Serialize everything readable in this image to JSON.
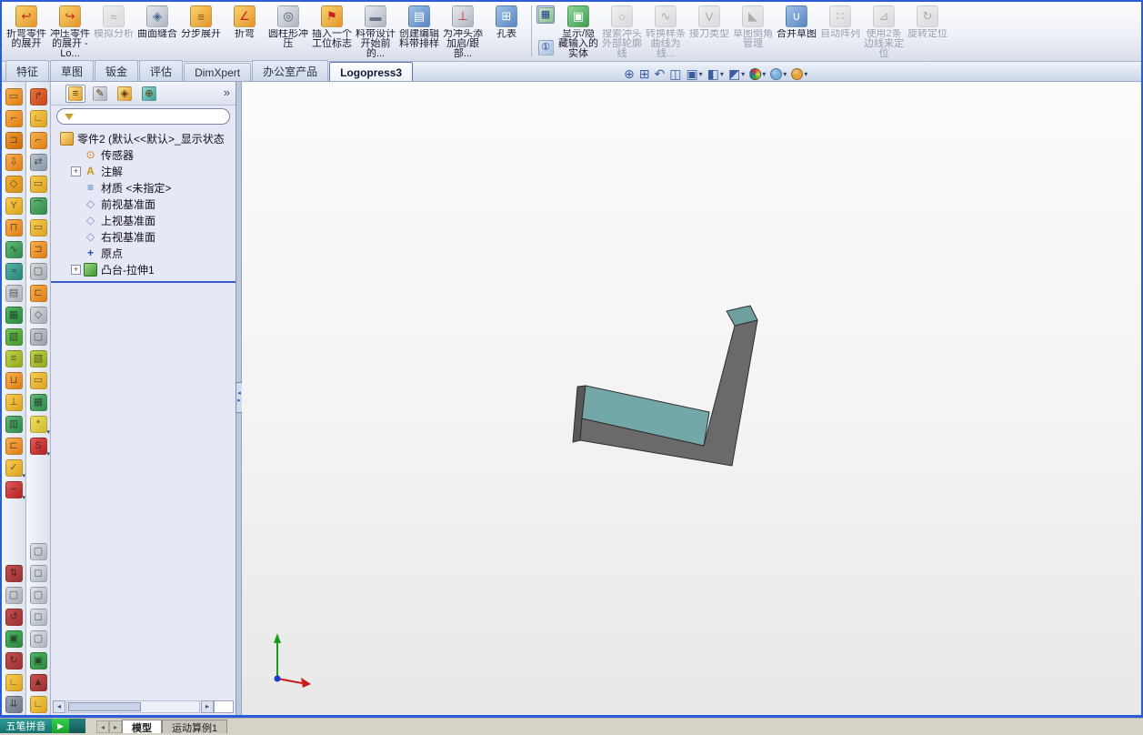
{
  "window": {
    "border_color": "#2b5bd7"
  },
  "toolbar": {
    "items": [
      {
        "name": "unfold-bent-part",
        "label": "折弯零件的展开",
        "enabled": true,
        "c1": "#fad46a",
        "c2": "#e2952e",
        "glyph": "↩",
        "gc": "#cc2020"
      },
      {
        "name": "unfold-stamped-part",
        "label": "冲压零件的展开 - Lo...",
        "enabled": true,
        "c1": "#fad46a",
        "c2": "#e2952e",
        "glyph": "↪",
        "gc": "#cc2020"
      },
      {
        "name": "simulation-analysis",
        "label": "模拟分析",
        "enabled": false,
        "c1": "#e2e4e8",
        "c2": "#c2c6cc",
        "glyph": "≈",
        "gc": "#667088"
      },
      {
        "name": "surface-knit",
        "label": "曲面缝合",
        "enabled": true,
        "c1": "#e6e9ee",
        "c2": "#aeb6c2",
        "glyph": "◈",
        "gc": "#4a6a9a"
      },
      {
        "name": "step-unfold",
        "label": "分步展开",
        "enabled": true,
        "c1": "#fad46a",
        "c2": "#e2952e",
        "glyph": "≡",
        "gc": "#8a5a10"
      },
      {
        "name": "bend",
        "label": "折弯",
        "enabled": true,
        "c1": "#fad46a",
        "c2": "#e2952e",
        "glyph": "∠",
        "gc": "#cc2020"
      },
      {
        "name": "cylindrical-stamp",
        "label": "圆柱形冲压",
        "enabled": true,
        "c1": "#e6e9ee",
        "c2": "#aeb6c2",
        "glyph": "◎",
        "gc": "#55606e"
      },
      {
        "name": "insert-station-flag",
        "label": "插入一个工位标志",
        "enabled": true,
        "c1": "#fad46a",
        "c2": "#e2952e",
        "glyph": "⚑",
        "gc": "#cc2020"
      },
      {
        "name": "strip-design-start",
        "label": "料带设计开始前的...",
        "enabled": true,
        "c1": "#e6e9ee",
        "c2": "#aeb6c2",
        "glyph": "▬",
        "gc": "#6a7482"
      },
      {
        "name": "create-edit-strip-layout",
        "label": "创建编辑料带排样",
        "enabled": true,
        "c1": "#9ec2e8",
        "c2": "#5a86c0",
        "glyph": "▤",
        "gc": "#ffffff"
      },
      {
        "name": "add-punch-heel",
        "label": "为冲头添加启/跟部...",
        "enabled": true,
        "c1": "#e6e9ee",
        "c2": "#aeb6c2",
        "glyph": "⊥",
        "gc": "#cc2020"
      },
      {
        "name": "hole-table",
        "label": "孔表",
        "enabled": true,
        "c1": "#9ec2e8",
        "c2": "#5a86c0",
        "glyph": "⊞",
        "gc": "#ffffff"
      },
      {
        "type": "sep"
      },
      {
        "type": "stack",
        "buttons": [
          {
            "n": "show-hide-strip-toggle",
            "g": "▦",
            "c1": "#cfe6cf",
            "c2": "#8fbf8f",
            "pressed": true
          },
          {
            "n": "info-toggle",
            "g": "①",
            "c1": "#dde6f5",
            "c2": "#aac0e0",
            "pressed": false
          }
        ]
      },
      {
        "name": "show-hide-imported-bodies",
        "label": "显示/隐藏输入的实体",
        "enabled": true,
        "c1": "#8fd89a",
        "c2": "#3f9c4f",
        "glyph": "▣",
        "gc": "#ffffff"
      },
      {
        "name": "search-punch-outline",
        "label": "搜索冲头外部轮廓线",
        "enabled": false,
        "c1": "#e2e4e8",
        "c2": "#c2c6cc",
        "glyph": "○",
        "gc": "#667088"
      },
      {
        "name": "convert-spline-to-line",
        "label": "转换样条曲线为线...",
        "enabled": false,
        "c1": "#e2e4e8",
        "c2": "#c2c6cc",
        "glyph": "∿",
        "gc": "#667088"
      },
      {
        "name": "joint-type",
        "label": "接刀类型",
        "enabled": false,
        "c1": "#e2e4e8",
        "c2": "#c2c6cc",
        "glyph": "V",
        "gc": "#667088"
      },
      {
        "name": "sketch-chamfer-manager",
        "label": "草图倒角管理",
        "enabled": false,
        "c1": "#e2e4e8",
        "c2": "#c2c6cc",
        "glyph": "◣",
        "gc": "#667088"
      },
      {
        "name": "merge-sketch",
        "label": "合并草图",
        "enabled": true,
        "c1": "#9ec2e8",
        "c2": "#5a86c0",
        "glyph": "∪",
        "gc": "#ffffff"
      },
      {
        "name": "auto-pattern",
        "label": "自动阵列",
        "enabled": false,
        "c1": "#e2e4e8",
        "c2": "#c2c6cc",
        "glyph": "∷",
        "gc": "#667088"
      },
      {
        "name": "locate-with-2-edges",
        "label": "使用2条边线来定位",
        "enabled": false,
        "c1": "#e2e4e8",
        "c2": "#c2c6cc",
        "glyph": "⊿",
        "gc": "#667088"
      },
      {
        "name": "rotate-locate",
        "label": "旋转定位",
        "enabled": false,
        "c1": "#e2e4e8",
        "c2": "#c2c6cc",
        "glyph": "↻",
        "gc": "#667088"
      }
    ]
  },
  "command_tabs": {
    "active": 6,
    "tabs": [
      {
        "id": "features",
        "label": "特征"
      },
      {
        "id": "sketch",
        "label": "草图"
      },
      {
        "id": "sheet-metal",
        "label": "钣金"
      },
      {
        "id": "evaluate",
        "label": "评估"
      },
      {
        "id": "dimxpert",
        "label": "DimXpert"
      },
      {
        "id": "office-products",
        "label": "办公室产品"
      },
      {
        "id": "logopress3",
        "label": "Logopress3"
      }
    ]
  },
  "left_toolbar_1": {
    "group1": [
      {
        "n": "a1",
        "c1": "#f6b24e",
        "c2": "#e07c16",
        "g": "▭"
      },
      {
        "n": "a2",
        "c1": "#f6b24e",
        "c2": "#e07c16",
        "g": "⌐"
      },
      {
        "n": "a3",
        "c1": "#ef9c30",
        "c2": "#cf6a0a",
        "g": "⊐"
      },
      {
        "n": "a4",
        "c1": "#f6b24e",
        "c2": "#e07c16",
        "g": "⇩"
      },
      {
        "n": "a5",
        "c1": "#f2ae3c",
        "c2": "#d89010",
        "g": "◇"
      },
      {
        "n": "a6",
        "c1": "#f8cc55",
        "c2": "#dca41e",
        "g": "Y"
      },
      {
        "n": "a7",
        "c1": "#f6b24e",
        "c2": "#e07c16",
        "g": "⊓"
      },
      {
        "n": "a8",
        "c1": "#63b877",
        "c2": "#2f8a49",
        "g": "∿"
      },
      {
        "n": "a9",
        "c1": "#55b2a4",
        "c2": "#2a8578",
        "g": "≈"
      },
      {
        "n": "a10",
        "c1": "#d6dade",
        "c2": "#aab0b8",
        "g": "▤"
      },
      {
        "n": "a11",
        "c1": "#52b464",
        "c2": "#2a8a3e",
        "g": "▦"
      },
      {
        "n": "a12",
        "c1": "#74c057",
        "c2": "#429a2f",
        "g": "▧"
      },
      {
        "n": "a13",
        "c1": "#c2d24a",
        "c2": "#94a81e",
        "g": "≡"
      },
      {
        "n": "a14",
        "c1": "#f6b24e",
        "c2": "#e07c16",
        "g": "⊔"
      },
      {
        "n": "a15",
        "c1": "#f8cc55",
        "c2": "#dca41e",
        "g": "⊥"
      },
      {
        "n": "a16",
        "c1": "#63b877",
        "c2": "#2f8a49",
        "g": "▥"
      },
      {
        "n": "a17",
        "c1": "#f6b24e",
        "c2": "#e07c16",
        "g": "⊏"
      },
      {
        "n": "a18",
        "c1": "#f8cc55",
        "c2": "#dca41e",
        "g": "✓",
        "v": true
      },
      {
        "n": "a19",
        "c1": "#e25858",
        "c2": "#b22222",
        "g": "∽",
        "v": true
      }
    ],
    "group2": [
      {
        "n": "b1",
        "c1": "#c85050",
        "c2": "#983030",
        "g": "⇅"
      },
      {
        "n": "b2",
        "c1": "#d6dade",
        "c2": "#a8aeb6",
        "g": "▢"
      },
      {
        "n": "b3",
        "c1": "#c85050",
        "c2": "#983030",
        "g": "↺"
      },
      {
        "n": "b4",
        "c1": "#52b464",
        "c2": "#2a8a3e",
        "g": "▣"
      },
      {
        "n": "b5",
        "c1": "#c85050",
        "c2": "#983030",
        "g": "↻"
      },
      {
        "n": "b6",
        "c1": "#f8cc55",
        "c2": "#dca41e",
        "g": "∟"
      },
      {
        "n": "b7",
        "c1": "#9aa4b2",
        "c2": "#6e7886",
        "g": "⇊"
      }
    ]
  },
  "left_toolbar_2": {
    "group1": [
      {
        "n": "c1",
        "c1": "#e87040",
        "c2": "#c84818",
        "g": "↱"
      },
      {
        "n": "c2",
        "c1": "#f8cc55",
        "c2": "#dca41e",
        "g": "∟"
      },
      {
        "n": "c3",
        "c1": "#f6b24e",
        "c2": "#e07c16",
        "g": "⌐"
      },
      {
        "n": "c4",
        "c1": "#b8c2d0",
        "c2": "#8a96a8",
        "g": "⇄"
      },
      {
        "n": "c5",
        "c1": "#f8cc55",
        "c2": "#dca41e",
        "g": "▭"
      },
      {
        "n": "c6",
        "c1": "#63b877",
        "c2": "#2f8a49",
        "g": "⌒"
      },
      {
        "n": "c7",
        "c1": "#f8cc55",
        "c2": "#dca41e",
        "g": "▭"
      },
      {
        "n": "c8",
        "c1": "#f6b24e",
        "c2": "#e07c16",
        "g": "⊐"
      },
      {
        "n": "c9",
        "c1": "#d6dade",
        "c2": "#a8aeb6",
        "g": "▢"
      },
      {
        "n": "c10",
        "c1": "#f6b24e",
        "c2": "#e07c16",
        "g": "⊏"
      },
      {
        "n": "c11",
        "c1": "#d6dade",
        "c2": "#a8aeb6",
        "g": "◇"
      },
      {
        "n": "c12",
        "c1": "#c8ccd4",
        "c2": "#9aa0aa",
        "g": "▢"
      },
      {
        "n": "c13",
        "c1": "#c2d24a",
        "c2": "#94a81e",
        "g": "▧"
      },
      {
        "n": "c14",
        "c1": "#f8cc55",
        "c2": "#dca41e",
        "g": "▭"
      },
      {
        "n": "c15",
        "c1": "#63b877",
        "c2": "#2f8a49",
        "g": "▦"
      },
      {
        "n": "c16",
        "c1": "#f0e060",
        "c2": "#d0b830",
        "g": "*",
        "v": true
      },
      {
        "n": "c17",
        "c1": "#e25858",
        "c2": "#b22222",
        "g": "S",
        "v": true
      }
    ],
    "group2": [
      {
        "n": "d1",
        "c1": "#dfe3e9",
        "c2": "#aeb6c0",
        "g": "▢"
      },
      {
        "n": "d2",
        "c1": "#dfe3e9",
        "c2": "#aeb6c0",
        "g": "◻"
      },
      {
        "n": "d3",
        "c1": "#dfe3e9",
        "c2": "#aeb6c0",
        "g": "▢"
      },
      {
        "n": "d4",
        "c1": "#dfe3e9",
        "c2": "#aeb6c0",
        "g": "◻"
      },
      {
        "n": "d5",
        "c1": "#dfe3e9",
        "c2": "#aeb6c0",
        "g": "▢"
      },
      {
        "n": "d6",
        "c1": "#52b464",
        "c2": "#2a8a3e",
        "g": "▣"
      },
      {
        "n": "d7",
        "c1": "#c85050",
        "c2": "#983030",
        "g": "▲"
      },
      {
        "n": "d8",
        "c1": "#f8cc55",
        "c2": "#dca41e",
        "g": "∟"
      }
    ]
  },
  "panel": {
    "chevron": "»",
    "tabs": [
      {
        "id": "featuremanager",
        "g": "≡",
        "c1": "#ffe08a",
        "c2": "#e09b2d",
        "active": true
      },
      {
        "id": "propertymanager",
        "g": "✎",
        "c1": "#e6e9ee",
        "c2": "#aeb6c2",
        "active": false
      },
      {
        "id": "configurationmanager",
        "g": "◈",
        "c1": "#ffe08a",
        "c2": "#e09b2d",
        "active": false
      },
      {
        "id": "dimxpertmanager",
        "g": "⊕",
        "c1": "#9ad8d0",
        "c2": "#3f9c94",
        "active": false
      }
    ],
    "filter": {
      "value": "",
      "placeholder": ""
    },
    "tree": {
      "root": {
        "id": "part2",
        "label": "零件2 (默认<<默认>_显示状态",
        "icon": "part",
        "glyph": ""
      },
      "items": [
        {
          "id": "sensors",
          "label": "传感器",
          "icon": "sensors",
          "glyph": "⊙",
          "expand": false
        },
        {
          "id": "annotations",
          "label": "注解",
          "icon": "annotations",
          "glyph": "A",
          "expand": true
        },
        {
          "id": "material",
          "label": "材质 <未指定>",
          "icon": "material",
          "glyph": "≡",
          "expand": false
        },
        {
          "id": "front-plane",
          "label": "前视基准面",
          "icon": "plane",
          "glyph": "◇",
          "expand": false
        },
        {
          "id": "top-plane",
          "label": "上视基准面",
          "icon": "plane",
          "glyph": "◇",
          "expand": false
        },
        {
          "id": "right-plane",
          "label": "右视基准面",
          "icon": "plane",
          "glyph": "◇",
          "expand": false
        },
        {
          "id": "origin",
          "label": "原点",
          "icon": "origin",
          "glyph": "+",
          "expand": false
        },
        {
          "id": "boss-extrude1",
          "label": "凸台-拉伸1",
          "icon": "extrude",
          "glyph": "",
          "expand": true
        }
      ]
    }
  },
  "viewport": {
    "colors": {
      "top_face": "#74a8a8",
      "cap_face": "#6fa0a0",
      "front_face": "#6a6a6a",
      "end_face": "#585858",
      "edge": "#2e2e2e"
    },
    "headsup": [
      {
        "n": "zoom-to-fit",
        "k": "g",
        "g": "⊕"
      },
      {
        "n": "zoom-to-area",
        "k": "g",
        "g": "⊞"
      },
      {
        "n": "previous-view",
        "k": "g",
        "g": "↶"
      },
      {
        "n": "section-view",
        "k": "g",
        "g": "◫"
      },
      {
        "n": "view-orientation",
        "k": "g",
        "g": "▣",
        "caret": true
      },
      {
        "n": "display-style",
        "k": "g",
        "g": "◧",
        "caret": true
      },
      {
        "n": "hide-show-items",
        "k": "g",
        "g": "◩",
        "caret": true
      },
      {
        "n": "edit-appearance",
        "k": "b",
        "color": "conic",
        "caret": true
      },
      {
        "n": "apply-scene",
        "k": "b",
        "color": "#7ab0e0",
        "caret": true
      },
      {
        "n": "view-settings",
        "k": "b",
        "color": "#e8a23a",
        "caret": true
      }
    ]
  },
  "statusbar": {
    "ime_label": "五笔拼音",
    "green_glyph": "▶",
    "tabs": [
      {
        "id": "model",
        "label": "模型",
        "active": true
      },
      {
        "id": "motion-study-1",
        "label": "运动算例1",
        "active": false
      }
    ]
  }
}
